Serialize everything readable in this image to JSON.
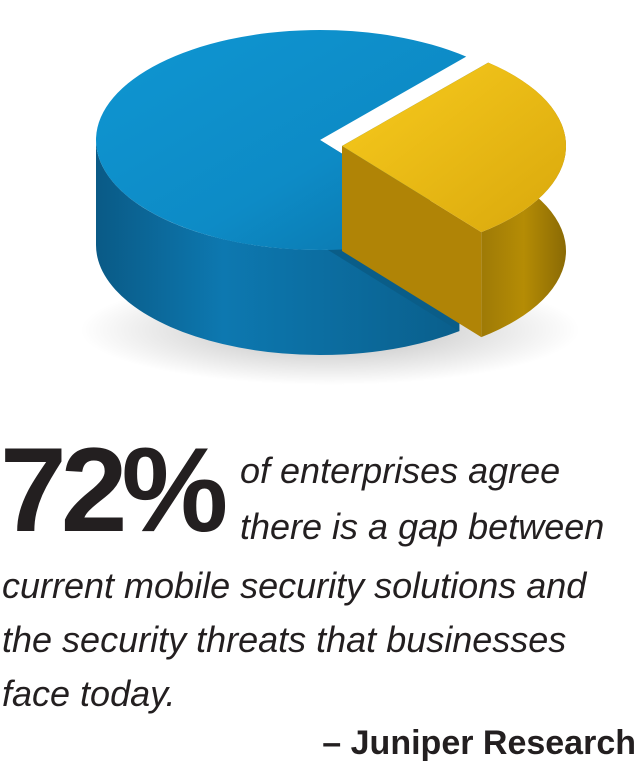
{
  "chart_data": {
    "type": "pie",
    "style": "3d",
    "slices": [
      {
        "value": 72,
        "color": "#0e8fcb"
      },
      {
        "value": 28,
        "color": "#f2bd14"
      }
    ],
    "colors": {
      "blue_top": "#0e8fcb",
      "blue_top_dark": "#0b6f9f",
      "blue_side": "#0a5f8c",
      "yellow_top": "#f6c417",
      "yellow_side": "#c09200"
    }
  },
  "stat": {
    "number": "72%",
    "text_lines": [
      "of enterprises agree",
      "there is a gap between",
      "current mobile security solutions and",
      "the security threats that businesses",
      "face today."
    ]
  },
  "source": "– Juniper Research"
}
